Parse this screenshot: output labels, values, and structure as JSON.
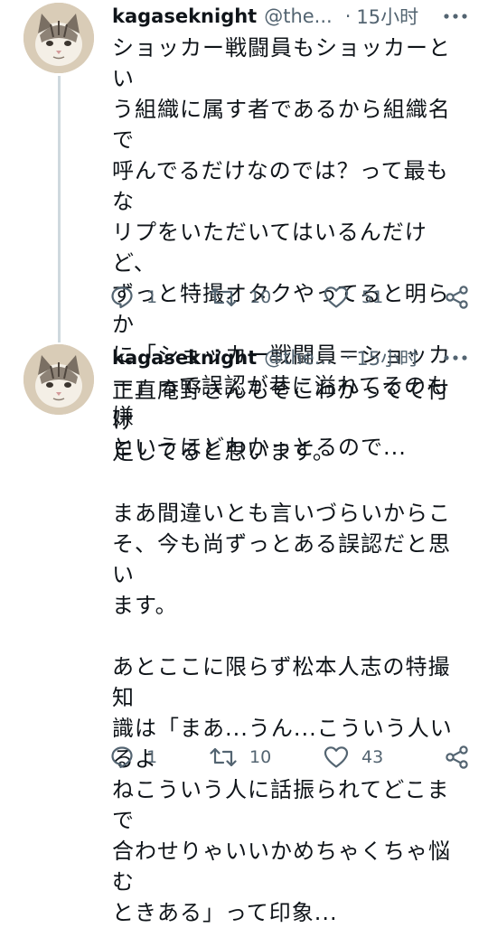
{
  "tweets": [
    {
      "author": {
        "name": "kagaseknight",
        "handle": "@the...",
        "avatar": "cat-avatar"
      },
      "separator": "·",
      "time": "15小时",
      "more_icon": "more-icon",
      "text_lines": [
        "ショッカー戦闘員もショッカーとい",
        "う組織に属す者であるから組織名で",
        "呼んでるだけなのでは？って最もな",
        "リプをいただいてはいるんだけど、",
        "ずっと特撮オタクやってると明らか",
        "に「ショッカー戦闘員＝ショッカ",
        "ー」って誤認が巷に溢れてるのも嫌",
        "というほどわかっとるので..."
      ],
      "actions": {
        "replies": "1",
        "retweets": "10",
        "likes": "51"
      }
    },
    {
      "author": {
        "name": "kagaseknight",
        "handle": "@the...",
        "avatar": "cat-avatar"
      },
      "separator": "·",
      "time": "15小时",
      "more_icon": "more-icon",
      "text_lines": [
        "正直庵野さんもそこわかってて付け",
        "足してると思います。",
        "",
        "まあ間違いとも言いづらいからこ",
        "そ、今も尚ずっとある誤認だと思い",
        "ます。",
        "",
        "あとここに限らず松本人志の特撮知",
        "識は「まあ...うん...こういう人いるよ",
        "ねこういう人に話振られてどこまで",
        "合わせりゃいいかめちゃくちゃ悩む",
        "ときある」って印象..."
      ],
      "actions": {
        "replies": "1",
        "retweets": "10",
        "likes": "43"
      }
    }
  ],
  "colors": {
    "text": "#0f1419",
    "secondary": "#536471",
    "thread": "#cfd9de"
  }
}
